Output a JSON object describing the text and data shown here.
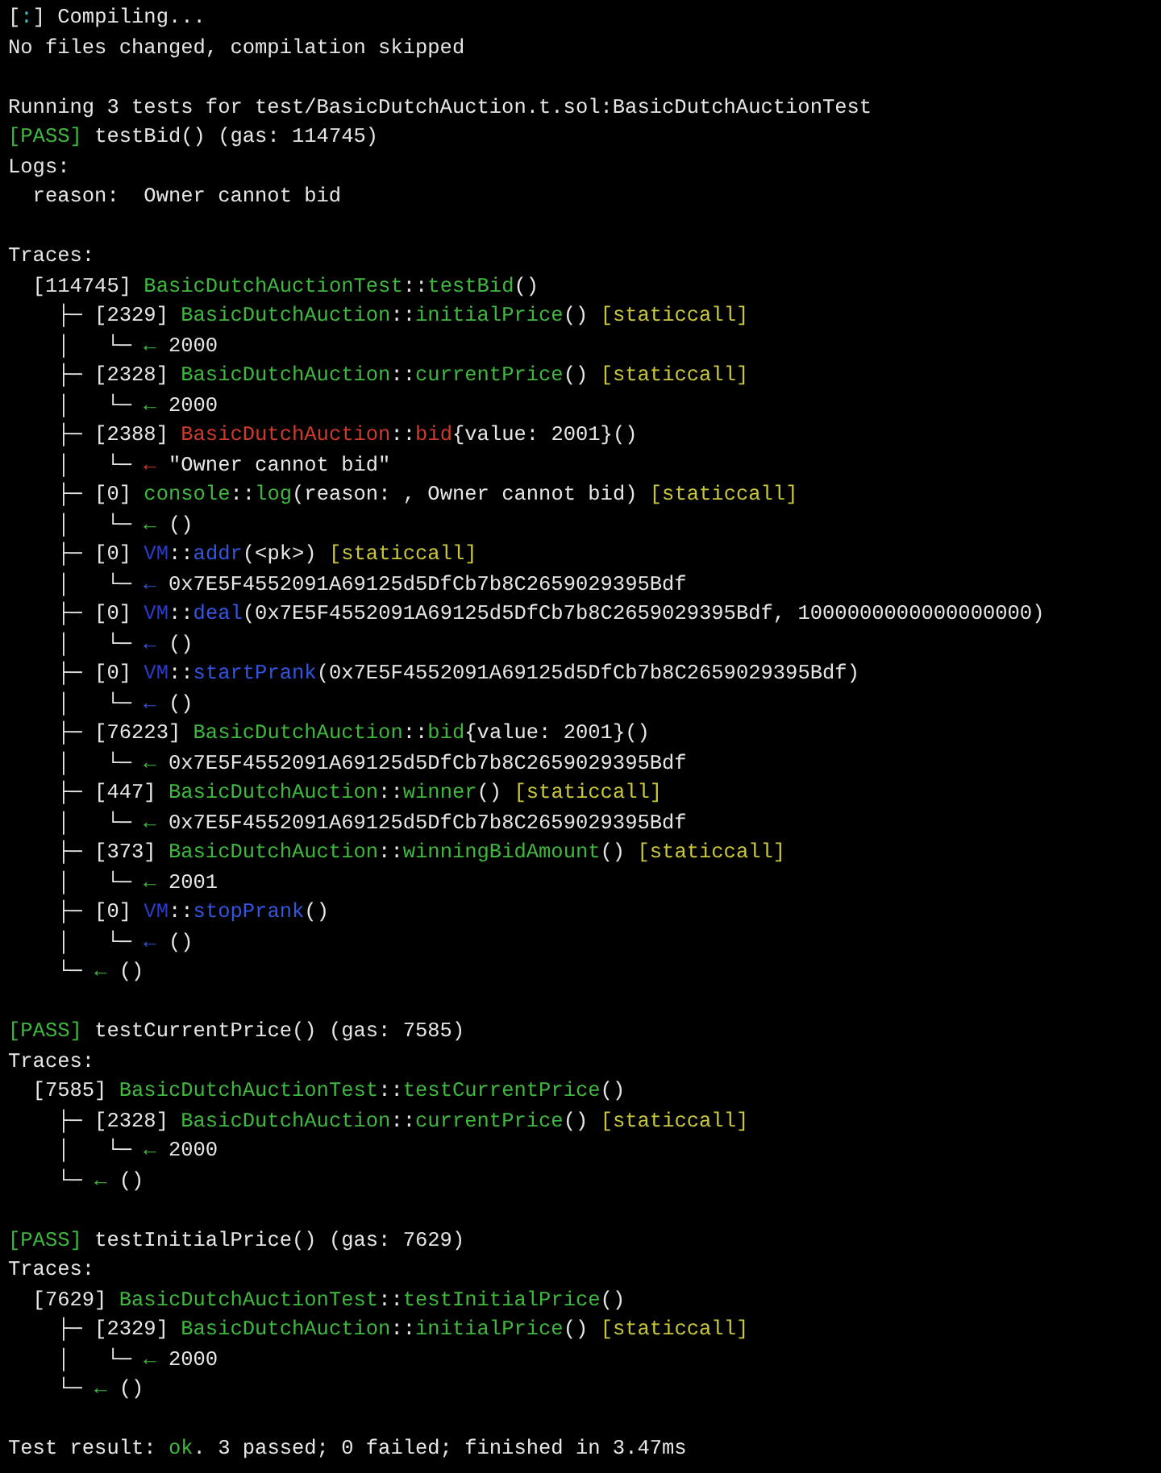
{
  "blocks": [
    {
      "lines": [
        [
          {
            "text": "["
          },
          {
            "text": ":",
            "color": "#38c0c0"
          },
          {
            "text": "] Compiling..."
          }
        ],
        [
          {
            "text": "No files changed, compilation skipped"
          }
        ]
      ]
    },
    {
      "lines": [
        [
          {
            "text": "Running 3 tests for test/BasicDutchAuction.t.sol:BasicDutchAuctionTest"
          }
        ],
        [
          {
            "text": "[PASS]",
            "color": "#3fb83f"
          },
          {
            "text": " testBid() (gas: 114745)"
          }
        ],
        [
          {
            "text": "Logs:"
          }
        ],
        [
          {
            "text": "  reason:  Owner cannot bid"
          }
        ]
      ]
    },
    {
      "lines": [
        [
          {
            "text": "Traces:"
          }
        ],
        [
          {
            "text": "  [114745] "
          },
          {
            "text": "BasicDutchAuctionTest",
            "color": "#3fb83f"
          },
          {
            "text": "::"
          },
          {
            "text": "testBid",
            "color": "#3fb83f"
          },
          {
            "text": "()"
          }
        ],
        [
          {
            "text": "    ├─ [2329] "
          },
          {
            "text": "BasicDutchAuction",
            "color": "#3fb83f"
          },
          {
            "text": "::"
          },
          {
            "text": "initialPrice",
            "color": "#3fb83f"
          },
          {
            "text": "() "
          },
          {
            "text": "[staticcall]",
            "color": "#c8c63c"
          }
        ],
        [
          {
            "text": "    │   └─ "
          },
          {
            "text": "←",
            "color": "#3fb83f"
          },
          {
            "text": " 2000"
          }
        ],
        [
          {
            "text": "    ├─ [2328] "
          },
          {
            "text": "BasicDutchAuction",
            "color": "#3fb83f"
          },
          {
            "text": "::"
          },
          {
            "text": "currentPrice",
            "color": "#3fb83f"
          },
          {
            "text": "() "
          },
          {
            "text": "[staticcall]",
            "color": "#c8c63c"
          }
        ],
        [
          {
            "text": "    │   └─ "
          },
          {
            "text": "←",
            "color": "#3fb83f"
          },
          {
            "text": " 2000"
          }
        ],
        [
          {
            "text": "    ├─ [2388] "
          },
          {
            "text": "BasicDutchAuction",
            "color": "#d03a2c"
          },
          {
            "text": "::"
          },
          {
            "text": "bid",
            "color": "#d03a2c"
          },
          {
            "text": "{value: 2001}()"
          }
        ],
        [
          {
            "text": "    │   └─ "
          },
          {
            "text": "←",
            "color": "#d03a2c"
          },
          {
            "text": " \"Owner cannot bid\""
          }
        ],
        [
          {
            "text": "    ├─ [0] "
          },
          {
            "text": "console",
            "color": "#3fb83f"
          },
          {
            "text": "::"
          },
          {
            "text": "log",
            "color": "#3fb83f"
          },
          {
            "text": "(reason: , Owner cannot bid) "
          },
          {
            "text": "[staticcall]",
            "color": "#c8c63c"
          }
        ],
        [
          {
            "text": "    │   └─ "
          },
          {
            "text": "←",
            "color": "#3fb83f"
          },
          {
            "text": " ()"
          }
        ],
        [
          {
            "text": "    ├─ [0] "
          },
          {
            "text": "VM",
            "color": "#2c3cc8"
          },
          {
            "text": "::"
          },
          {
            "text": "addr",
            "color": "#3355e0"
          },
          {
            "text": "(<pk>) "
          },
          {
            "text": "[staticcall]",
            "color": "#c8c63c"
          }
        ],
        [
          {
            "text": "    │   └─ "
          },
          {
            "text": "←",
            "color": "#3355e0"
          },
          {
            "text": " 0x7E5F4552091A69125d5DfCb7b8C2659029395Bdf"
          }
        ],
        [
          {
            "text": "    ├─ [0] "
          },
          {
            "text": "VM",
            "color": "#2c3cc8"
          },
          {
            "text": "::"
          },
          {
            "text": "deal",
            "color": "#3355e0"
          },
          {
            "text": "(0x7E5F4552091A69125d5DfCb7b8C2659029395Bdf, 1000000000000000000)"
          }
        ],
        [
          {
            "text": "    │   └─ "
          },
          {
            "text": "←",
            "color": "#3355e0"
          },
          {
            "text": " ()"
          }
        ],
        [
          {
            "text": "    ├─ [0] "
          },
          {
            "text": "VM",
            "color": "#2c3cc8"
          },
          {
            "text": "::"
          },
          {
            "text": "startPrank",
            "color": "#3355e0"
          },
          {
            "text": "(0x7E5F4552091A69125d5DfCb7b8C2659029395Bdf)"
          }
        ],
        [
          {
            "text": "    │   └─ "
          },
          {
            "text": "←",
            "color": "#3355e0"
          },
          {
            "text": " ()"
          }
        ],
        [
          {
            "text": "    ├─ [76223] "
          },
          {
            "text": "BasicDutchAuction",
            "color": "#3fb83f"
          },
          {
            "text": "::"
          },
          {
            "text": "bid",
            "color": "#3fb83f"
          },
          {
            "text": "{value: 2001}()"
          }
        ],
        [
          {
            "text": "    │   └─ "
          },
          {
            "text": "←",
            "color": "#3fb83f"
          },
          {
            "text": " 0x7E5F4552091A69125d5DfCb7b8C2659029395Bdf"
          }
        ],
        [
          {
            "text": "    ├─ [447] "
          },
          {
            "text": "BasicDutchAuction",
            "color": "#3fb83f"
          },
          {
            "text": "::"
          },
          {
            "text": "winner",
            "color": "#3fb83f"
          },
          {
            "text": "() "
          },
          {
            "text": "[staticcall]",
            "color": "#c8c63c"
          }
        ],
        [
          {
            "text": "    │   └─ "
          },
          {
            "text": "←",
            "color": "#3fb83f"
          },
          {
            "text": " 0x7E5F4552091A69125d5DfCb7b8C2659029395Bdf"
          }
        ],
        [
          {
            "text": "    ├─ [373] "
          },
          {
            "text": "BasicDutchAuction",
            "color": "#3fb83f"
          },
          {
            "text": "::"
          },
          {
            "text": "winningBidAmount",
            "color": "#3fb83f"
          },
          {
            "text": "() "
          },
          {
            "text": "[staticcall]",
            "color": "#c8c63c"
          }
        ],
        [
          {
            "text": "    │   └─ "
          },
          {
            "text": "←",
            "color": "#3fb83f"
          },
          {
            "text": " 2001"
          }
        ],
        [
          {
            "text": "    ├─ [0] "
          },
          {
            "text": "VM",
            "color": "#2c3cc8"
          },
          {
            "text": "::"
          },
          {
            "text": "stopPrank",
            "color": "#3355e0"
          },
          {
            "text": "()"
          }
        ],
        [
          {
            "text": "    │   └─ "
          },
          {
            "text": "←",
            "color": "#3355e0"
          },
          {
            "text": " ()"
          }
        ],
        [
          {
            "text": "    └─ "
          },
          {
            "text": "←",
            "color": "#3fb83f"
          },
          {
            "text": " ()"
          }
        ]
      ]
    },
    {
      "lines": [
        [
          {
            "text": "[PASS]",
            "color": "#3fb83f"
          },
          {
            "text": " testCurrentPrice() (gas: 7585)"
          }
        ],
        [
          {
            "text": "Traces:"
          }
        ],
        [
          {
            "text": "  [7585] "
          },
          {
            "text": "BasicDutchAuctionTest",
            "color": "#3fb83f"
          },
          {
            "text": "::"
          },
          {
            "text": "testCurrentPrice",
            "color": "#3fb83f"
          },
          {
            "text": "()"
          }
        ],
        [
          {
            "text": "    ├─ [2328] "
          },
          {
            "text": "BasicDutchAuction",
            "color": "#3fb83f"
          },
          {
            "text": "::"
          },
          {
            "text": "currentPrice",
            "color": "#3fb83f"
          },
          {
            "text": "() "
          },
          {
            "text": "[staticcall]",
            "color": "#c8c63c"
          }
        ],
        [
          {
            "text": "    │   └─ "
          },
          {
            "text": "←",
            "color": "#3fb83f"
          },
          {
            "text": " 2000"
          }
        ],
        [
          {
            "text": "    └─ "
          },
          {
            "text": "←",
            "color": "#3fb83f"
          },
          {
            "text": " ()"
          }
        ]
      ]
    },
    {
      "lines": [
        [
          {
            "text": "[PASS]",
            "color": "#3fb83f"
          },
          {
            "text": " testInitialPrice() (gas: 7629)"
          }
        ],
        [
          {
            "text": "Traces:"
          }
        ],
        [
          {
            "text": "  [7629] "
          },
          {
            "text": "BasicDutchAuctionTest",
            "color": "#3fb83f"
          },
          {
            "text": "::"
          },
          {
            "text": "testInitialPrice",
            "color": "#3fb83f"
          },
          {
            "text": "()"
          }
        ],
        [
          {
            "text": "    ├─ [2329] "
          },
          {
            "text": "BasicDutchAuction",
            "color": "#3fb83f"
          },
          {
            "text": "::"
          },
          {
            "text": "initialPrice",
            "color": "#3fb83f"
          },
          {
            "text": "() "
          },
          {
            "text": "[staticcall]",
            "color": "#c8c63c"
          }
        ],
        [
          {
            "text": "    │   └─ "
          },
          {
            "text": "←",
            "color": "#3fb83f"
          },
          {
            "text": " 2000"
          }
        ],
        [
          {
            "text": "    └─ "
          },
          {
            "text": "←",
            "color": "#3fb83f"
          },
          {
            "text": " ()"
          }
        ]
      ]
    },
    {
      "lines": [
        [
          {
            "text": "Test result: "
          },
          {
            "text": "ok",
            "color": "#3fb83f"
          },
          {
            "text": ". 3 passed; 0 failed; finished in 3.47ms"
          }
        ]
      ]
    }
  ]
}
